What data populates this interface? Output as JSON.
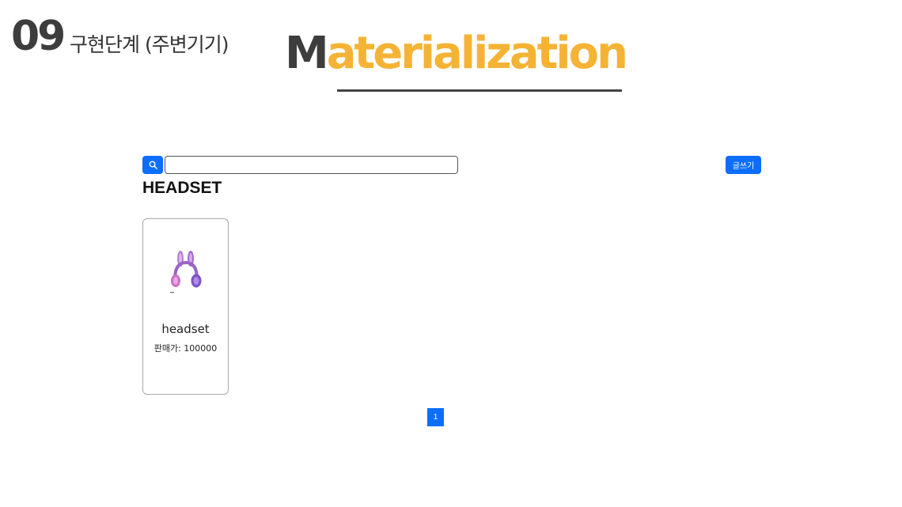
{
  "slide": {
    "number": "09",
    "subtitle": "구현단계 (주변기기)",
    "title_first_letter": "M",
    "title_rest": "aterialization",
    "colors": {
      "title_dark": "#3d3d3d",
      "title_accent": "#f5b335"
    }
  },
  "toolbar": {
    "search_icon": "search-icon",
    "search_value": "",
    "write_label": "글쓰기",
    "accent": "#0d6efd"
  },
  "category": {
    "title": "HEADSET"
  },
  "products": [
    {
      "name": "headset",
      "price_text": "판매가: 100000",
      "image_icon": "headset-image"
    }
  ],
  "pagination": {
    "current": "1"
  }
}
